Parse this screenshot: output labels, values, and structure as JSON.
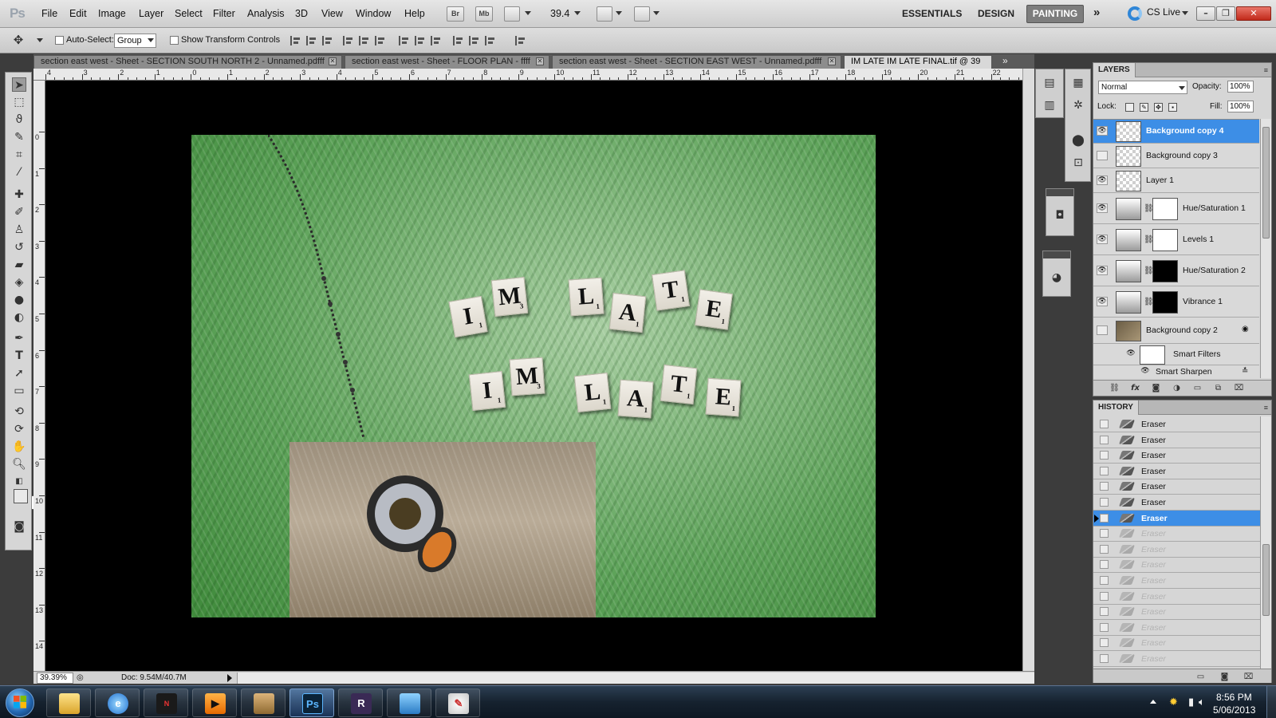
{
  "app": {
    "logo": "Ps"
  },
  "menubar": {
    "items": [
      "File",
      "Edit",
      "Image",
      "Layer",
      "Select",
      "Filter",
      "Analysis",
      "3D",
      "View",
      "Window",
      "Help"
    ],
    "bridge_button": "Br",
    "minibridge_button": "Mb",
    "zoom": "39.4",
    "workspaces": [
      "ESSENTIALS",
      "DESIGN",
      "PAINTING"
    ],
    "active_workspace": "PAINTING",
    "cs_live": "CS Live"
  },
  "options": {
    "auto_select_label": "Auto-Select:",
    "auto_select_value": "Group",
    "transform_label": "Show Transform Controls"
  },
  "tabs": [
    {
      "label": "section east west - Sheet - SECTION SOUTH NORTH 2 - Unnamed.pdfff",
      "active": false
    },
    {
      "label": "section east west - Sheet - FLOOR PLAN - ffff",
      "active": false
    },
    {
      "label": "section east west - Sheet - SECTION EAST WEST - Unnamed.pdfff",
      "active": false
    },
    {
      "label": "IM LATE IM LATE FINAL.tif @ 39",
      "active": true
    }
  ],
  "rulers": {
    "horizontal": [
      "4",
      "3",
      "2",
      "1",
      "0",
      "1",
      "2",
      "3",
      "4",
      "5",
      "6",
      "7",
      "8",
      "9",
      "10",
      "11",
      "12",
      "13",
      "14",
      "15",
      "16",
      "17",
      "18",
      "19",
      "20",
      "21",
      "22"
    ],
    "vertical": [
      "0",
      "1",
      "2",
      "3",
      "4",
      "5",
      "6",
      "7",
      "8",
      "9",
      "10",
      "11",
      "12",
      "13",
      "14"
    ]
  },
  "canvas": {
    "image_title": "IM LATE IM LATE FINAL.tif",
    "tiles": [
      {
        "letter": "I",
        "points": "1"
      },
      {
        "letter": "M",
        "points": "3"
      },
      {
        "letter": "L",
        "points": "1"
      },
      {
        "letter": "A",
        "points": "1"
      },
      {
        "letter": "T",
        "points": "1"
      },
      {
        "letter": "E",
        "points": "1"
      },
      {
        "letter": "I",
        "points": "1"
      },
      {
        "letter": "M",
        "points": "3"
      },
      {
        "letter": "L",
        "points": "1"
      },
      {
        "letter": "A",
        "points": "1"
      },
      {
        "letter": "T",
        "points": "1"
      },
      {
        "letter": "E",
        "points": "1"
      }
    ]
  },
  "status": {
    "zoom": "39.39%",
    "doc": "Doc: 9.54M/40.7M"
  },
  "layers": {
    "tab": "LAYERS",
    "blend_mode": "Normal",
    "opacity_label": "Opacity:",
    "opacity": "100%",
    "lock_label": "Lock:",
    "fill_label": "Fill:",
    "fill": "100%",
    "items": [
      {
        "name": "Background copy 4",
        "visible": true,
        "selected": true
      },
      {
        "name": "Background copy 3",
        "visible": false,
        "selected": false
      },
      {
        "name": "Layer 1",
        "visible": true,
        "selected": false
      },
      {
        "name": "Hue/Saturation 1",
        "visible": true,
        "selected": false
      },
      {
        "name": "Levels 1",
        "visible": true,
        "selected": false
      },
      {
        "name": "Hue/Saturation 2",
        "visible": true,
        "selected": false
      },
      {
        "name": "Vibrance 1",
        "visible": true,
        "selected": false
      },
      {
        "name": "Background copy 2",
        "visible": false,
        "selected": false
      },
      {
        "name": "Smart Filters",
        "visible": true,
        "selected": false
      },
      {
        "name": "Smart Sharpen",
        "visible": true,
        "selected": false
      }
    ]
  },
  "history": {
    "tab": "HISTORY",
    "items": [
      {
        "label": "Eraser",
        "state": "normal"
      },
      {
        "label": "Eraser",
        "state": "normal"
      },
      {
        "label": "Eraser",
        "state": "normal"
      },
      {
        "label": "Eraser",
        "state": "normal"
      },
      {
        "label": "Eraser",
        "state": "normal"
      },
      {
        "label": "Eraser",
        "state": "normal"
      },
      {
        "label": "Eraser",
        "state": "selected"
      },
      {
        "label": "Eraser",
        "state": "undone"
      },
      {
        "label": "Eraser",
        "state": "undone"
      },
      {
        "label": "Eraser",
        "state": "undone"
      },
      {
        "label": "Eraser",
        "state": "undone"
      },
      {
        "label": "Eraser",
        "state": "undone"
      },
      {
        "label": "Eraser",
        "state": "undone"
      },
      {
        "label": "Eraser",
        "state": "undone"
      },
      {
        "label": "Eraser",
        "state": "undone"
      },
      {
        "label": "Eraser",
        "state": "undone"
      },
      {
        "label": "Eraser",
        "state": "undone"
      }
    ]
  },
  "taskbar": {
    "apps": [
      {
        "name": "Windows Explorer",
        "icon": "folder-icon"
      },
      {
        "name": "Internet Explorer",
        "icon": "internet-explorer-icon"
      },
      {
        "name": "Nero",
        "icon": "nero-icon"
      },
      {
        "name": "Media Player",
        "icon": "media-player-icon"
      },
      {
        "name": "Sketchbook",
        "icon": "sketchbook-icon"
      },
      {
        "name": "Photoshop",
        "icon": "photoshop-icon"
      },
      {
        "name": "Revit",
        "icon": "revit-icon"
      },
      {
        "name": "Photo Viewer",
        "icon": "photo-viewer-icon"
      },
      {
        "name": "Paint",
        "icon": "paint-icon"
      }
    ],
    "photoshop_label": "Ps",
    "time": "8:56 PM",
    "date": "5/06/2013"
  },
  "colors": {
    "selection": "#3d8ee6",
    "canvas_bg": "#000000",
    "fur_green": "#5ea35a"
  }
}
